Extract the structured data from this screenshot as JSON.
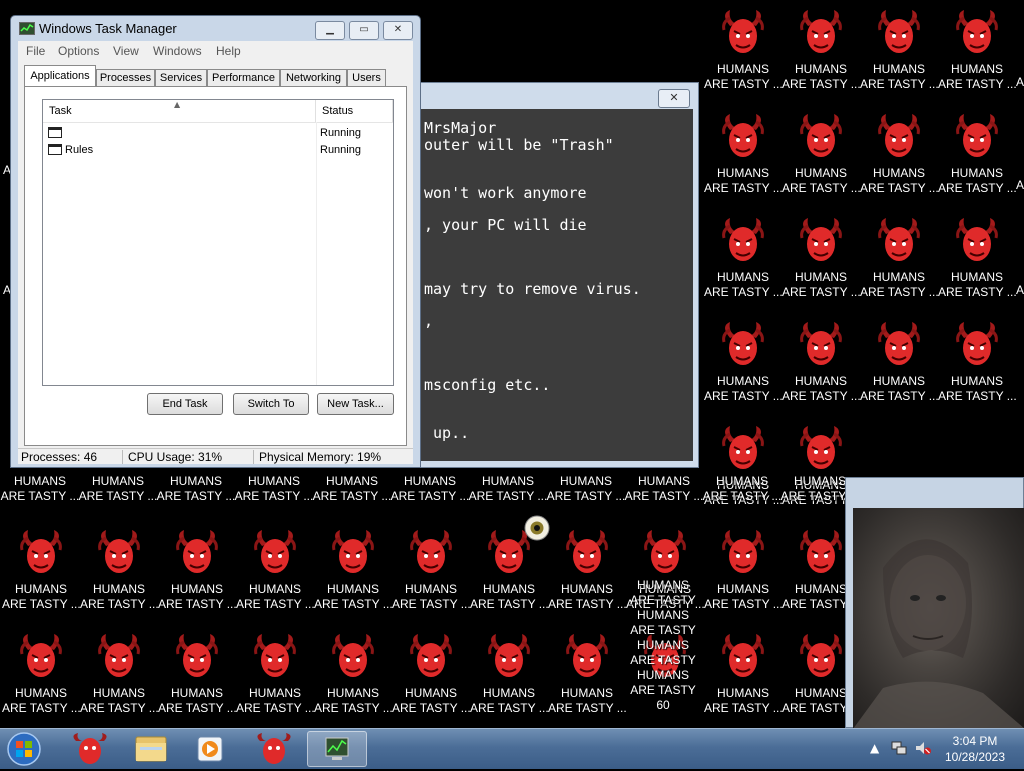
{
  "desktop": {
    "icon_label_line1": "HUMANS",
    "icon_label_line2": "ARE TASTY ...",
    "icon_label_line2_short": "ARE TASTY",
    "stray_a": "A",
    "overlap_label_last": "ARE TASTY 60",
    "colors": {
      "background": "#000000",
      "demon": "#e02a2a"
    }
  },
  "virus_window": {
    "lines": [
      "MrsMajor",
      "outer will be \"Trash\"",
      "won't work anymore",
      ", your PC will die",
      "may try to remove virus.",
      ",",
      "msconfig etc..",
      " up.."
    ]
  },
  "task_manager": {
    "title": "Windows Task Manager",
    "menu": [
      "File",
      "Options",
      "View",
      "Windows",
      "Help"
    ],
    "tabs": [
      "Applications",
      "Processes",
      "Services",
      "Performance",
      "Networking",
      "Users"
    ],
    "active_tab": "Applications",
    "columns": {
      "task": "Task",
      "status": "Status"
    },
    "rows": [
      {
        "task": "",
        "status": "Running"
      },
      {
        "task": "Rules",
        "status": "Running"
      }
    ],
    "buttons": {
      "end_task": "End Task",
      "switch_to": "Switch To",
      "new_task": "New Task..."
    },
    "status": {
      "processes": "Processes: 46",
      "cpu": "CPU Usage: 31%",
      "memory": "Physical Memory: 19%"
    }
  },
  "taskbar": {
    "time": "3:04 PM",
    "date": "10/28/2023",
    "items": [
      "start-orb",
      "demon-app",
      "windows-explorer",
      "media-player",
      "demon-app-2",
      "task-manager"
    ]
  }
}
